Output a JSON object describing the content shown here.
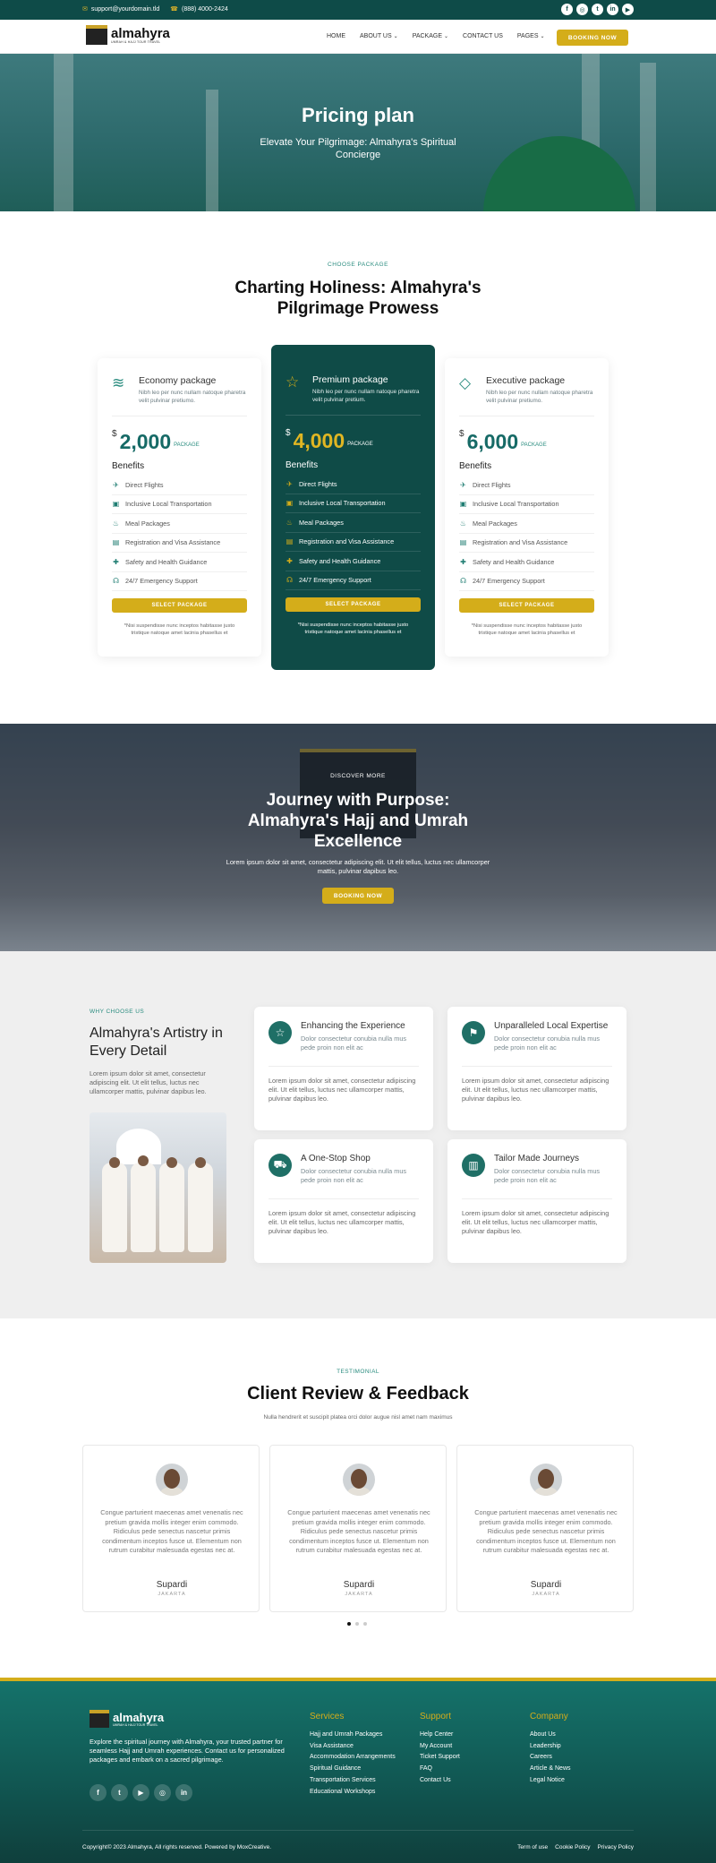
{
  "topbar": {
    "email": "support@yourdomain.tld",
    "phone": "(888) 4000-2424",
    "socials": [
      "f",
      "◎",
      "t",
      "in",
      "▶"
    ]
  },
  "header": {
    "brand": "almahyra",
    "brand_tag": "UMRAH & HAJJ TOUR TRAVEL",
    "nav": [
      "HOME",
      "ABOUT US",
      "PACKAGE",
      "CONTACT US",
      "PAGES"
    ],
    "cta": "BOOKING NOW"
  },
  "hero": {
    "title": "Pricing plan",
    "subtitle": "Elevate Your Pilgrimage: Almahyra's Spiritual Concierge"
  },
  "pricing": {
    "eyebrow": "CHOOSE PACKAGE",
    "title": "Charting Holiness: Almahyra's Pilgrimage Prowess",
    "benefits_title": "Benefits",
    "benefits": [
      "Direct Flights",
      "Inclusive Local Transportation",
      "Meal Packages",
      "Registration and Visa Assistance",
      "Safety and Health Guidance",
      "24/7 Emergency Support"
    ],
    "button": "SELECT PACKAGE",
    "note": "*Nisi suspendisse nunc inceptos habitasse justo tristique natoque amet lacinia phasellus et",
    "currency": "$",
    "price_label": "PACKAGE",
    "packages": [
      {
        "name": "Economy package",
        "desc": "Nibh leo per nunc nullam natoque pharetra velit pulvinar pretiumo.",
        "price": "2,000",
        "icon": "layers-icon"
      },
      {
        "name": "Premium package",
        "desc": "Nibh leo per nunc nullam natoque pharetra velit pulvinar pretium.",
        "price": "4,000",
        "icon": "star-icon"
      },
      {
        "name": "Executive package",
        "desc": "Nibh leo per nunc nullam natoque pharetra velit pulvinar pretiumo.",
        "price": "6,000",
        "icon": "diamond-icon"
      }
    ]
  },
  "journey": {
    "eyebrow": "DISCOVER MORE",
    "title": "Journey with Purpose: Almahyra's Hajj and Umrah Excellence",
    "text": "Lorem ipsum dolor sit amet, consectetur adipiscing elit. Ut elit tellus, luctus nec ullamcorper mattis, pulvinar dapibus leo.",
    "button": "BOOKING NOW"
  },
  "why": {
    "eyebrow": "WHY CHOOSE US",
    "title": "Almahyra's Artistry in Every Detail",
    "lead": "Lorem ipsum dolor sit amet, consectetur adipiscing elit. Ut elit tellus, luctus nec ullamcorper mattis, pulvinar dapibus leo.",
    "features": [
      {
        "title": "Enhancing the Experience",
        "desc": "Dolor consectetur conubia nulla mus pede proin non elit ac",
        "body": "Lorem ipsum dolor sit amet, consectetur adipiscing elit. Ut elit tellus, luctus nec ullamcorper mattis, pulvinar dapibus leo.",
        "icon": "star-icon"
      },
      {
        "title": "Unparalleled Local Expertise",
        "desc": "Dolor consectetur conubia nulla mus pede proin non elit ac",
        "body": "Lorem ipsum dolor sit amet, consectetur adipiscing elit. Ut elit tellus, luctus nec ullamcorper mattis, pulvinar dapibus leo.",
        "icon": "flag-icon"
      },
      {
        "title": "A One-Stop Shop",
        "desc": "Dolor consectetur conubia nulla mus pede proin non elit ac",
        "body": "Lorem ipsum dolor sit amet, consectetur adipiscing elit. Ut elit tellus, luctus nec ullamcorper mattis, pulvinar dapibus leo.",
        "icon": "cart-icon"
      },
      {
        "title": "Tailor Made Journeys",
        "desc": "Dolor consectetur conubia nulla mus pede proin non elit ac",
        "body": "Lorem ipsum dolor sit amet, consectetur adipiscing elit. Ut elit tellus, luctus nec ullamcorper mattis, pulvinar dapibus leo.",
        "icon": "map-icon"
      }
    ]
  },
  "testimonials": {
    "eyebrow": "TESTIMONIAL",
    "title": "Client Review & Feedback",
    "subtitle": "Nulla hendrerit et suscipit platea orci dolor augue nisl amet nam maximus",
    "items": [
      {
        "quote": "Congue parturient maecenas amet venenatis nec pretium gravida mollis integer enim commodo. Ridiculus pede senectus nascetur primis condimentum inceptos fusce ut. Elementum non rutrum curabitur malesuada egestas nec at.",
        "name": "Supardi",
        "role": "JAKARTA"
      },
      {
        "quote": "Congue parturient maecenas amet venenatis nec pretium gravida mollis integer enim commodo. Ridiculus pede senectus nascetur primis condimentum inceptos fusce ut. Elementum non rutrum curabitur malesuada egestas nec at.",
        "name": "Supardi",
        "role": "JAKARTA"
      },
      {
        "quote": "Congue parturient maecenas amet venenatis nec pretium gravida mollis integer enim commodo. Ridiculus pede senectus nascetur primis condimentum inceptos fusce ut. Elementum non rutrum curabitur malesuada egestas nec at.",
        "name": "Supardi",
        "role": "JAKARTA"
      }
    ]
  },
  "footer": {
    "brand": "almahyra",
    "brand_tag": "UMRAH & HAJJ TOUR TRAVEL",
    "about": "Explore the spiritual journey with Almahyra, your trusted partner for seamless Hajj and Umrah experiences. Contact us for personalized packages and embark on a sacred pilgrimage.",
    "socials": [
      "f",
      "t",
      "▶",
      "◎",
      "in"
    ],
    "columns": [
      {
        "title": "Services",
        "links": [
          "Hajj and Umrah Packages",
          "Visa Assistance",
          "Accommodation Arrangements",
          "Spiritual Guidance",
          "Transportation Services",
          "Educational Workshops"
        ]
      },
      {
        "title": "Support",
        "links": [
          "Help Center",
          "My Account",
          "Ticket Support",
          "FAQ",
          "Contact Us"
        ]
      },
      {
        "title": "Company",
        "links": [
          "About Us",
          "Leadership",
          "Careers",
          "Article & News",
          "Legal Notice"
        ]
      }
    ],
    "copyright": "Copyright© 2023 Almahyra, All rights reserved. Powered by MoxCreative.",
    "legal": [
      "Term of use",
      "Cookie Policy",
      "Privacy Policy"
    ]
  }
}
